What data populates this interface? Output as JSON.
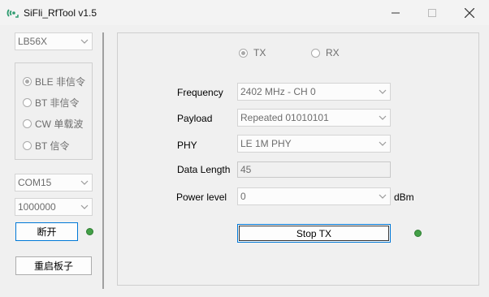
{
  "window": {
    "title": "SiFli_RfTool v1.5",
    "minimize": "—",
    "maximize": "☐",
    "close": "✕"
  },
  "left": {
    "chip_select": "LB56X",
    "modes": [
      {
        "label": "BLE 非信令",
        "selected": true
      },
      {
        "label": "BT  非信令",
        "selected": false
      },
      {
        "label": "CW 单载波",
        "selected": false
      },
      {
        "label": "BT  信令",
        "selected": false
      }
    ],
    "port_select": "COM15",
    "baud_select": "1000000",
    "disconnect_label": "断开",
    "reboot_label": "重启板子",
    "status_color": "#43a047"
  },
  "main": {
    "tx_label": "TX",
    "rx_label": "RX",
    "tx_selected": true,
    "fields": {
      "frequency_label": "Frequency",
      "frequency_value": "2402 MHz - CH 0",
      "payload_label": "Payload",
      "payload_value": "Repeated 01010101",
      "phy_label": "PHY",
      "phy_value": "LE 1M PHY",
      "data_length_label": "Data Length",
      "data_length_value": "45",
      "power_label": "Power level",
      "power_value": "0",
      "power_unit": "dBm"
    },
    "stop_tx_label": "Stop TX",
    "status_color": "#43a047"
  }
}
